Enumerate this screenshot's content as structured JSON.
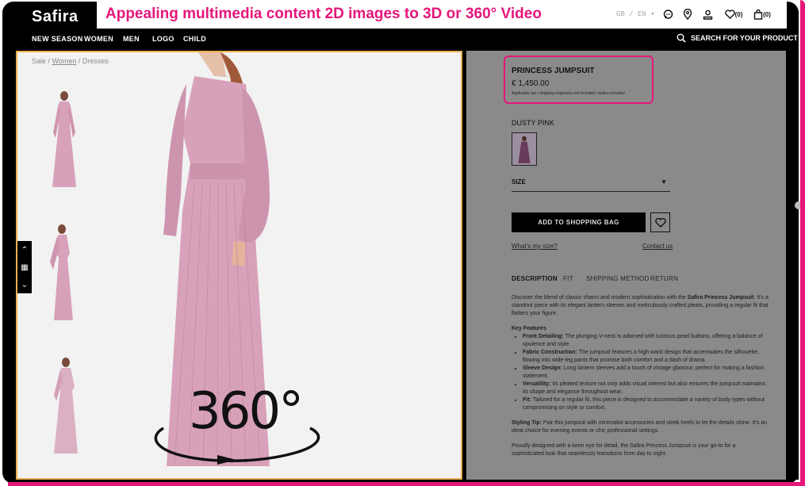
{
  "banner": {
    "title": "Appealing multimedia content 2D images to 3D or 360° Video"
  },
  "logo": {
    "text_main": "Safira",
    "text_accent": ""
  },
  "header": {
    "locale": "GB / EN",
    "wishlist_count": "(0)",
    "bag_count": "(0)"
  },
  "nav": {
    "items": [
      "NEW SEASON",
      "WOMEN",
      "MEN",
      "LOGO",
      "CHILD"
    ],
    "search_label": "SEARCH FOR YOUR PRODUCT"
  },
  "breadcrumb": {
    "part1": "Sale",
    "sep1": " / ",
    "part2": "Women",
    "sep2": " / ",
    "part3": "Dresses"
  },
  "gallery": {
    "overlay_text": "360°"
  },
  "product": {
    "title": "PRINCESS JUMPSUIT",
    "price": "€ 1,450.00",
    "tax_note": "Applicable tax / shipping expenses not included / duties included",
    "color_label": "DUSTY PINK",
    "size_label": "SIZE",
    "add_to_bag": "ADD TO SHOPPING BAG",
    "whats_my_size": "What's my size?",
    "contact_us": "Contact us"
  },
  "tabs": [
    "DESCRIPTION",
    "FIT",
    "SHIPPING METHOD",
    "RETURN"
  ],
  "description": {
    "intro_a": "Discover the blend of classic charm and modern sophistication with the ",
    "intro_b": "Safira Princess Jumpsuit",
    "intro_c": ". It's a standout piece with its elegant lantern sleeves and meticulously crafted pleats, providing a regular fit that flatters your figure.",
    "features_title": "Key Features",
    "features": [
      {
        "k": "Front Detailing:",
        "v": " The plunging V-neck is adorned with lustrous pearl buttons, offering a balance of opulence and style."
      },
      {
        "k": "Fabric Construction:",
        "v": " The jumpsuit features a high waist design that accentuates the silhouette, flowing into wide-leg pants that promise both comfort and a dash of drama."
      },
      {
        "k": "Sleeve Design:",
        "v": " Long lantern sleeves add a touch of vintage glamour, perfect for making a fashion statement."
      },
      {
        "k": "Versatility:",
        "v": " Its pleated texture not only adds visual interest but also ensures the jumpsuit maintains its shape and elegance throughout wear."
      },
      {
        "k": "Fit:",
        "v": " Tailored for a regular fit, this piece is designed to accommodate a variety of body types without compromising on style or comfort."
      }
    ],
    "styling_k": "Styling Tip:",
    "styling_v": " Pair this jumpsuit with minimalist accessories and sleek heels to let the details shine. It's an ideal choice for evening events or chic professional settings.",
    "closing": "Proudly designed with a keen eye for detail, the Safira Princess Jumpsuit is your go-to for a sophisticated look that seamlessly transitions from day to night."
  },
  "colors": {
    "accent": "#e6167a",
    "panel": "#8a8a8a",
    "dress": "#d79fb8"
  }
}
